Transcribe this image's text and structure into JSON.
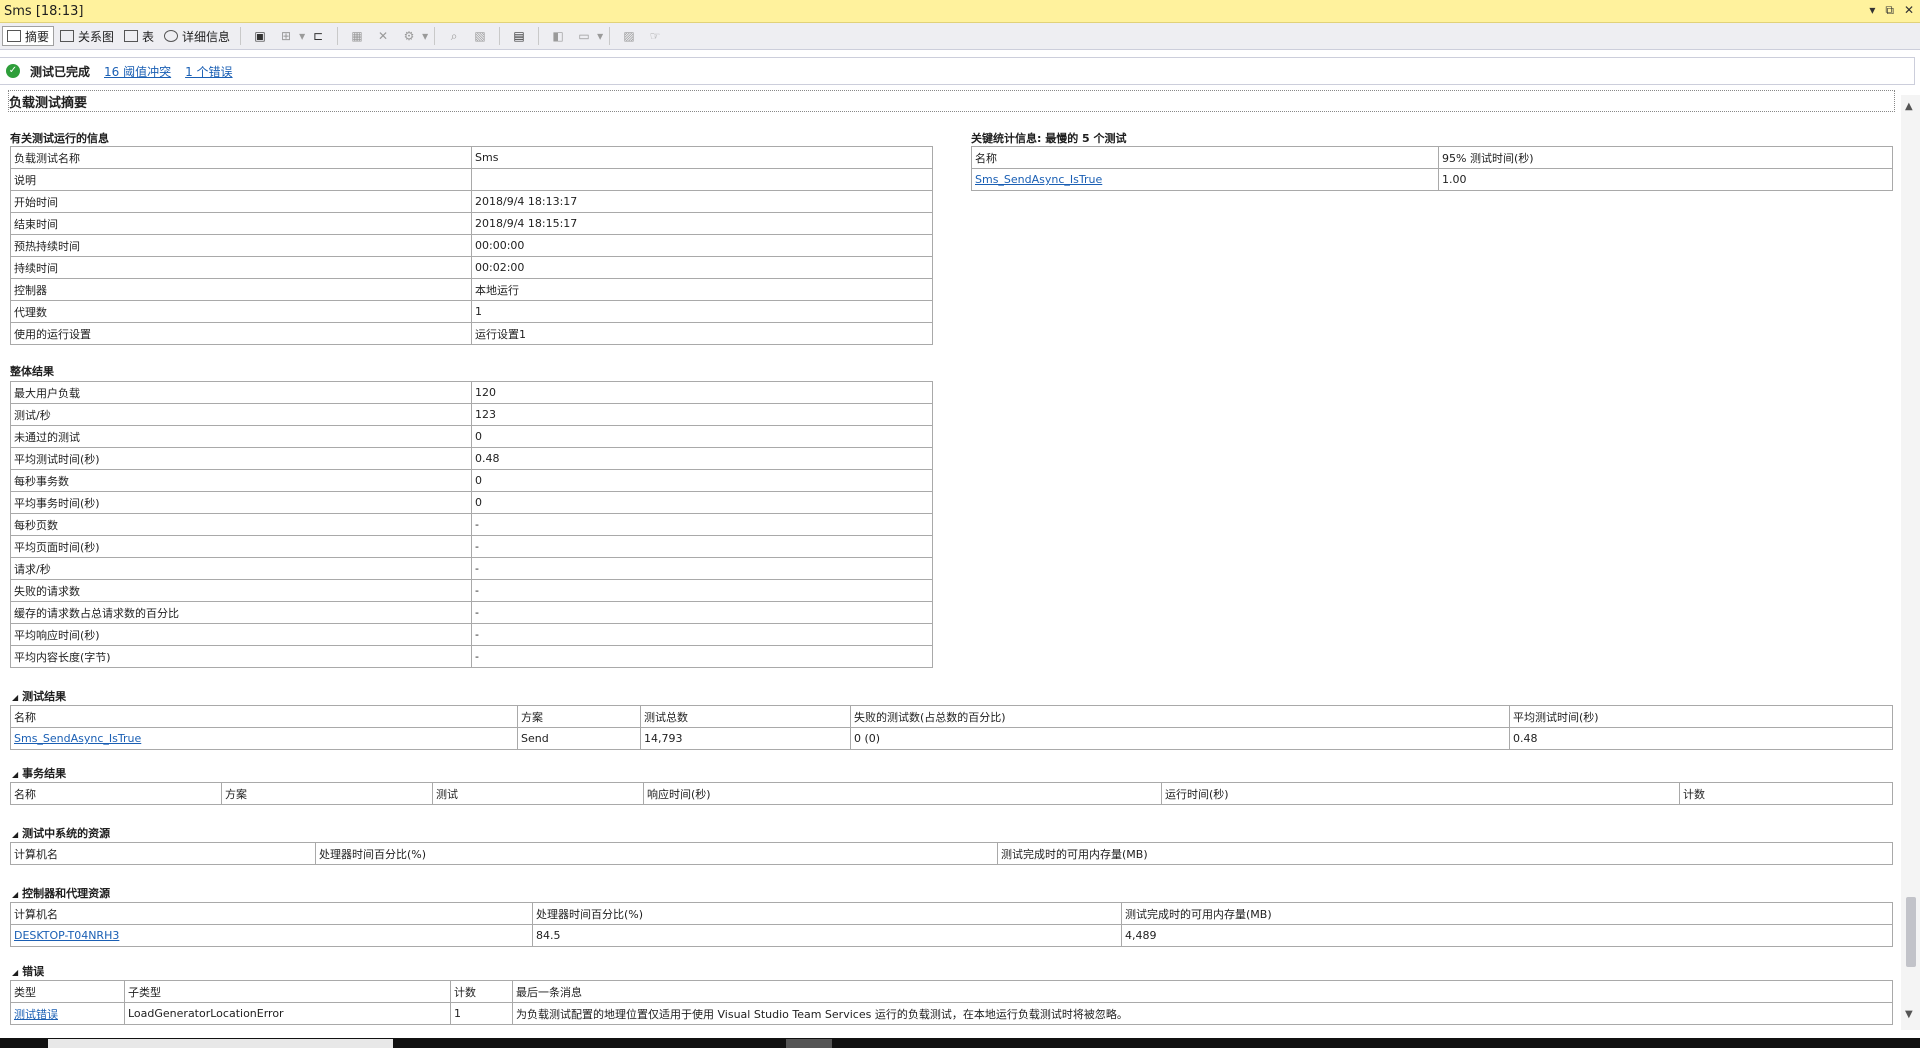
{
  "window": {
    "title": "Sms [18:13]",
    "controls": [
      "▾",
      "⧉",
      "✕"
    ]
  },
  "toolbar": {
    "summary": "摘要",
    "graph": "关系图",
    "table": "表",
    "details": "详细信息"
  },
  "status": {
    "icon": "check-icon",
    "text": "测试已完成",
    "threshold_link": "16 阈值冲突",
    "error_link": "1 个错误"
  },
  "page_title": "负载测试摘要",
  "run_info": {
    "heading": "有关测试运行的信息",
    "rows": [
      {
        "label": "负载测试名称",
        "value": "Sms"
      },
      {
        "label": "说明",
        "value": ""
      },
      {
        "label": "开始时间",
        "value": "2018/9/4 18:13:17"
      },
      {
        "label": "结束时间",
        "value": "2018/9/4 18:15:17"
      },
      {
        "label": "预热持续时间",
        "value": "00:00:00"
      },
      {
        "label": "持续时间",
        "value": "00:02:00"
      },
      {
        "label": "控制器",
        "value": "本地运行"
      },
      {
        "label": "代理数",
        "value": "1"
      },
      {
        "label": "使用的运行设置",
        "value": "运行设置1"
      }
    ]
  },
  "key_stats": {
    "heading": "关键统计信息: 最慢的 5 个测试",
    "headers": [
      "名称",
      "95% 测试时间(秒)"
    ],
    "rows": [
      {
        "name": "Sms_SendAsync_IsTrue",
        "value": "1.00"
      }
    ]
  },
  "overall": {
    "heading": "整体结果",
    "rows": [
      {
        "label": "最大用户负载",
        "value": "120"
      },
      {
        "label": "测试/秒",
        "value": "123"
      },
      {
        "label": "未通过的测试",
        "value": "0"
      },
      {
        "label": "平均测试时间(秒)",
        "value": "0.48"
      },
      {
        "label": "每秒事务数",
        "value": "0"
      },
      {
        "label": "平均事务时间(秒)",
        "value": "0"
      },
      {
        "label": "每秒页数",
        "value": "-"
      },
      {
        "label": "平均页面时间(秒)",
        "value": "-"
      },
      {
        "label": "请求/秒",
        "value": "-"
      },
      {
        "label": "失败的请求数",
        "value": "-"
      },
      {
        "label": "缓存的请求数占总请求数的百分比",
        "value": "-"
      },
      {
        "label": "平均响应时间(秒)",
        "value": "-"
      },
      {
        "label": "平均内容长度(字节)",
        "value": "-"
      }
    ]
  },
  "test_results": {
    "heading": "测试结果",
    "headers": [
      "名称",
      "方案",
      "测试总数",
      "失败的测试数(占总数的百分比)",
      "平均测试时间(秒)"
    ],
    "rows": [
      [
        "Sms_SendAsync_IsTrue",
        "Send",
        "14,793",
        "0 (0)",
        "0.48"
      ]
    ]
  },
  "transaction_results": {
    "heading": "事务结果",
    "headers": [
      "名称",
      "方案",
      "测试",
      "响应时间(秒)",
      "运行时间(秒)",
      "计数"
    ]
  },
  "system_resources": {
    "heading": "测试中系统的资源",
    "headers": [
      "计算机名",
      "处理器时间百分比(%)",
      "测试完成时的可用内存量(MB)"
    ]
  },
  "controller_resources": {
    "heading": "控制器和代理资源",
    "headers": [
      "计算机名",
      "处理器时间百分比(%)",
      "测试完成时的可用内存量(MB)"
    ],
    "rows": [
      [
        "DESKTOP-T04NRH3",
        "84.5",
        "4,489"
      ]
    ]
  },
  "errors": {
    "heading": "错误",
    "headers": [
      "类型",
      "子类型",
      "计数",
      "最后一条消息"
    ],
    "rows": [
      [
        "测试错误",
        "LoadGeneratorLocationError",
        "1",
        "为负载测试配置的地理位置仅适用于使用 Visual Studio Team Services 运行的负载测试，在本地运行负载测试时将被忽略。"
      ]
    ]
  }
}
